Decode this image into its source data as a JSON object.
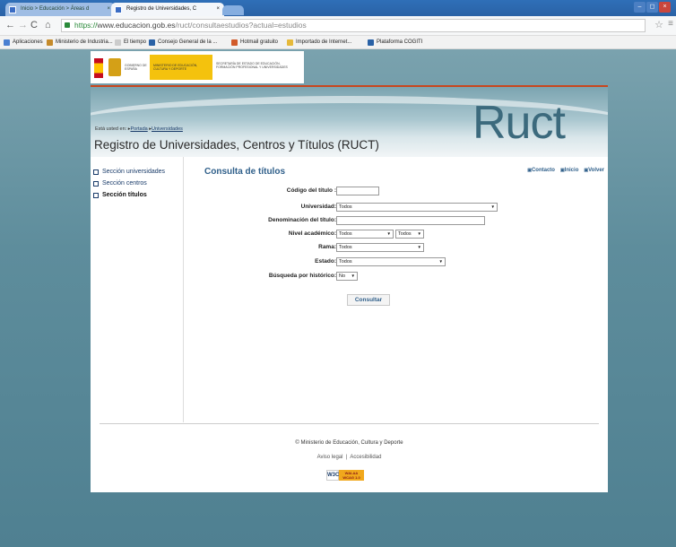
{
  "browser": {
    "tabs": [
      {
        "label": "Inicio > Educación > Áreas d",
        "close": "×"
      },
      {
        "label": "Registro de Universidades, C",
        "close": "×"
      }
    ],
    "window_buttons": [
      "–",
      "◻",
      "×"
    ],
    "url": {
      "scheme": "https://",
      "host": "www.educacion.gob.es",
      "path": "/ruct/consultaestudios?actual=estudios"
    },
    "bookmarks": [
      {
        "label": "Aplicaciones",
        "color": "#4a7fd1"
      },
      {
        "label": "Ministerio de Industria...",
        "color": "#c58a2a"
      },
      {
        "label": "El tiempo",
        "color": "#cccccc"
      },
      {
        "label": "Consejo General de la ...",
        "color": "#2a62a6"
      },
      {
        "label": "Hotmail gratuito",
        "color": "#d15b2a"
      },
      {
        "label": "Importado de Internet...",
        "color": "#e6b93a"
      },
      {
        "label": "Plataforma COGITI",
        "color": "#2a62a6"
      }
    ]
  },
  "header": {
    "gov_left": "GOBIERNO DE ESPAÑA",
    "gov_ministry": "MINISTERIO DE EDUCACIÓN, CULTURA Y DEPORTE",
    "gov_secretary": "SECRETARÍA DE ESTADO DE EDUCACIÓN, FORMACIÓN PROFESIONAL Y UNIVERSIDADES",
    "logo": "Ruct",
    "breadcrumb_prefix": "Está usted en:",
    "breadcrumb_1": "Portada",
    "breadcrumb_2": "Universidades",
    "title": "Registro de Universidades, Centros y Títulos (RUCT)"
  },
  "sidebar": {
    "items": [
      {
        "label": "Sección universidades"
      },
      {
        "label": "Sección centros"
      },
      {
        "label": "Sección títulos"
      }
    ]
  },
  "main": {
    "heading": "Consulta de títulos",
    "links": [
      "Contacto",
      "Inicio",
      "Volver"
    ],
    "form": {
      "codigo_label": "Código del título :",
      "codigo_value": "",
      "universidad_label": "Universidad:",
      "universidad_value": "Todos",
      "denominacion_label": "Denominación del título:",
      "denominacion_value": "",
      "nivel_label": "Nivel académico:",
      "nivel_value": "Todos",
      "nivel_value2": "Todos",
      "rama_label": "Rama:",
      "rama_value": "Todos",
      "estado_label": "Estado:",
      "estado_value": "Todos",
      "historico_label": "Búsqueda por histórico:",
      "historico_value": "No"
    },
    "submit_label": "Consultar"
  },
  "footer": {
    "copyright": "© Ministerio de Educación, Cultura y Deporte",
    "aviso": "Aviso legal",
    "accesibilidad": "Accesibilidad",
    "wai_logo": "W3C",
    "wai_badge": "WAI-AA WCAG 1.0"
  }
}
